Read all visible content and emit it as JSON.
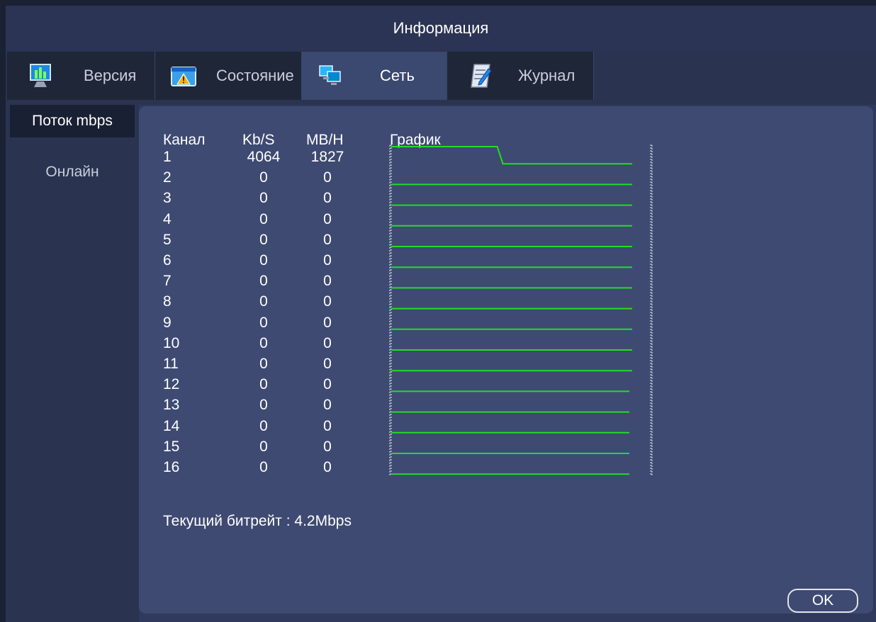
{
  "window_title": "Информация",
  "tabs": [
    {
      "label": "Версия",
      "icon": "monitor-chart-icon"
    },
    {
      "label": "Состояние",
      "icon": "warning-window-icon"
    },
    {
      "label": "Сеть",
      "icon": "network-computers-icon"
    },
    {
      "label": "Журнал",
      "icon": "notepad-pen-icon"
    }
  ],
  "active_tab": "Сеть",
  "sidebar": {
    "items": [
      {
        "label": "Поток mbps",
        "active": true
      },
      {
        "label": "Онлайн",
        "active": false
      }
    ]
  },
  "table": {
    "headers": {
      "channel": "Канал",
      "kbs": "Kb/S",
      "mbh": "MB/H",
      "graph": "График"
    },
    "rows": [
      {
        "channel": "1",
        "kbs": "4064",
        "mbh": "1827"
      },
      {
        "channel": "2",
        "kbs": "0",
        "mbh": "0"
      },
      {
        "channel": "3",
        "kbs": "0",
        "mbh": "0"
      },
      {
        "channel": "4",
        "kbs": "0",
        "mbh": "0"
      },
      {
        "channel": "5",
        "kbs": "0",
        "mbh": "0"
      },
      {
        "channel": "6",
        "kbs": "0",
        "mbh": "0"
      },
      {
        "channel": "7",
        "kbs": "0",
        "mbh": "0"
      },
      {
        "channel": "8",
        "kbs": "0",
        "mbh": "0"
      },
      {
        "channel": "9",
        "kbs": "0",
        "mbh": "0"
      },
      {
        "channel": "10",
        "kbs": "0",
        "mbh": "0"
      },
      {
        "channel": "11",
        "kbs": "0",
        "mbh": "0"
      },
      {
        "channel": "12",
        "kbs": "0",
        "mbh": "0"
      },
      {
        "channel": "13",
        "kbs": "0",
        "mbh": "0"
      },
      {
        "channel": "14",
        "kbs": "0",
        "mbh": "0"
      },
      {
        "channel": "15",
        "kbs": "0",
        "mbh": "0"
      },
      {
        "channel": "16",
        "kbs": "0",
        "mbh": "0"
      }
    ]
  },
  "graph_color": "#22dd22",
  "graph_level_channel1": {
    "before_drop": 1.0,
    "after_drop": 0.0,
    "drop_fraction": 0.44
  },
  "current_bitrate_label": "Текущий битрейт : 4.2Mbps",
  "ok_label": "OK",
  "colors": {
    "background": "#2f3a5c",
    "panel": "#3e4a72",
    "active_sidebar": "#1a2033"
  }
}
